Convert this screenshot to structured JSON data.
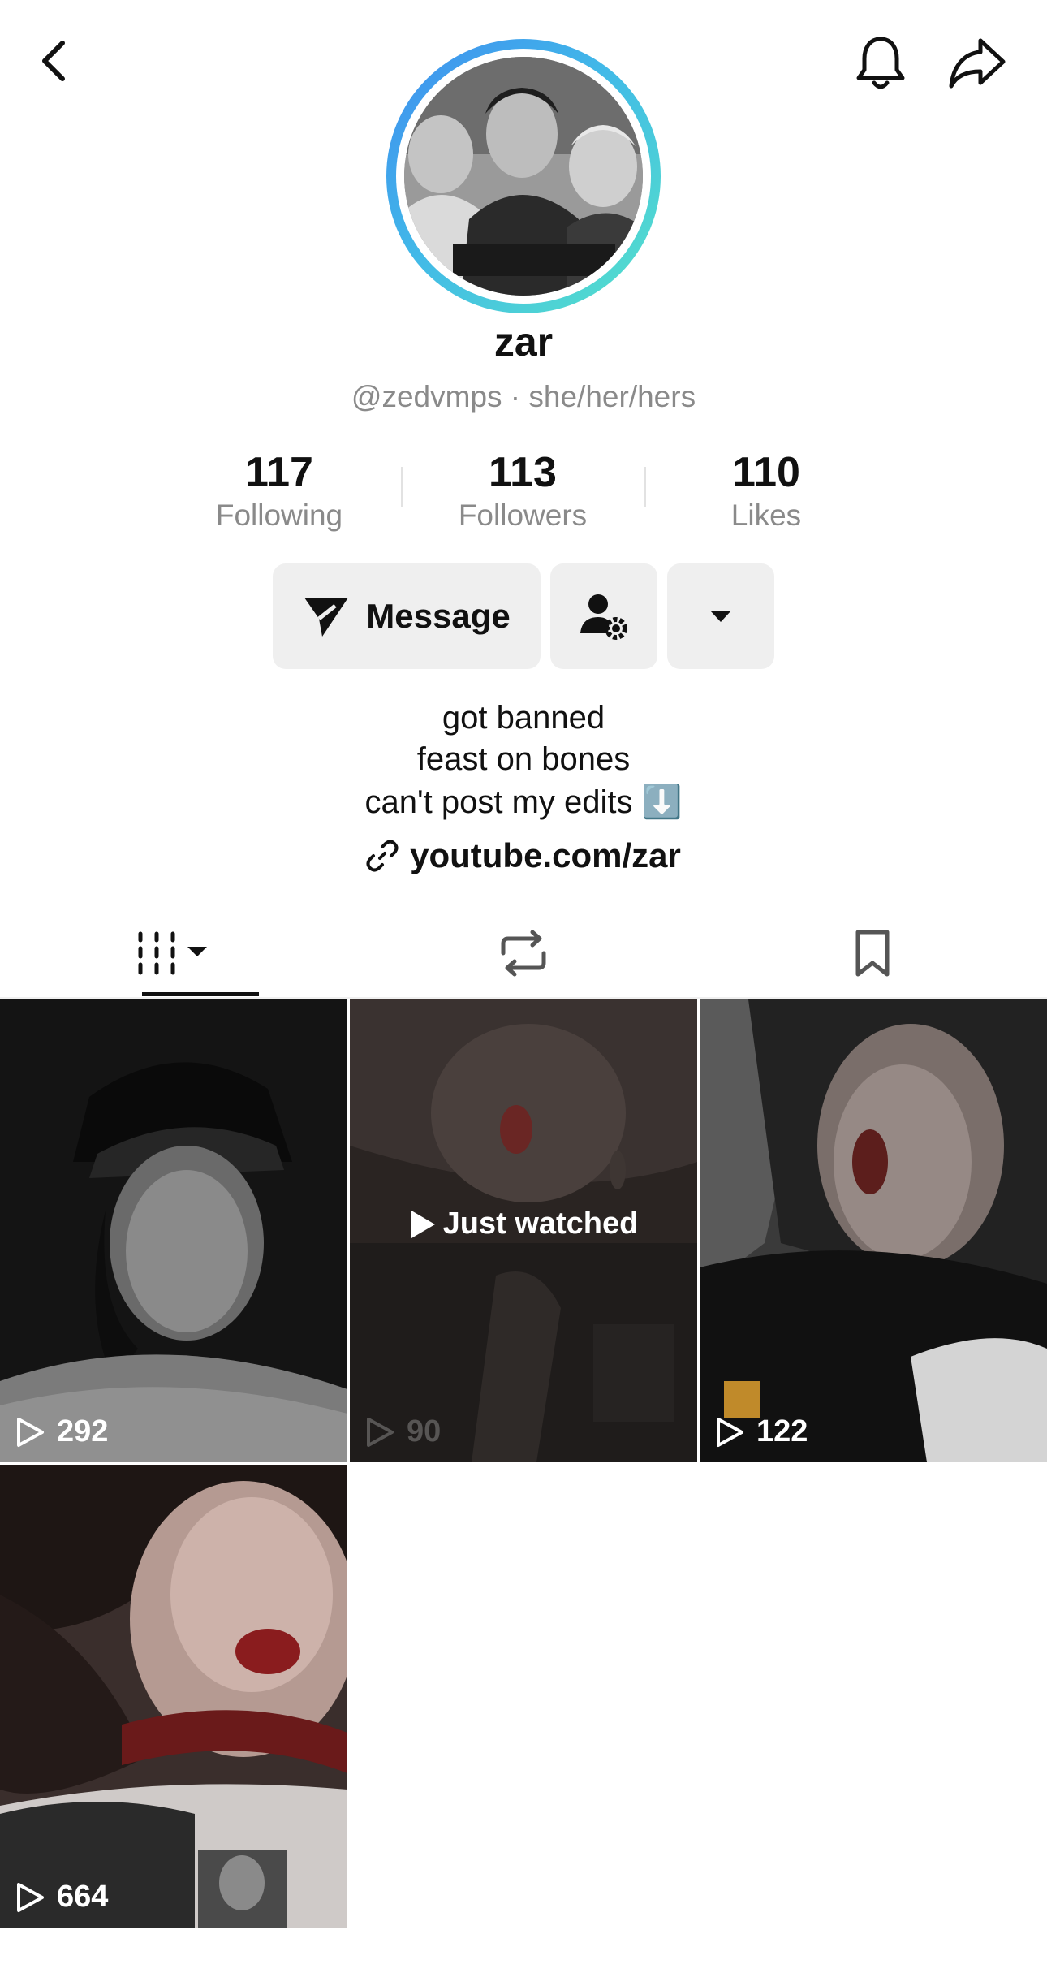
{
  "profile": {
    "name": "zar",
    "handle_line": "@zedvmps · she/her/hers"
  },
  "stats": [
    {
      "value": "117",
      "label": "Following"
    },
    {
      "value": "113",
      "label": "Followers"
    },
    {
      "value": "110",
      "label": "Likes"
    }
  ],
  "actions": {
    "message_label": "Message"
  },
  "bio": {
    "line1": "got banned",
    "line2": "feast on bones",
    "line3": "can't post my edits ⬇️",
    "link": "youtube.com/zar"
  },
  "tabs": [
    "videos-grid-icon",
    "repost-icon",
    "bookmark-icon"
  ],
  "videos": [
    {
      "views": "292"
    },
    {
      "views": "90",
      "overlay": "Just watched"
    },
    {
      "views": "122"
    },
    {
      "views": "664"
    }
  ],
  "colors": {
    "ring_start": "#3f8cf0",
    "ring_end": "#56e3c8",
    "button_bg": "#efefef",
    "secondary_text": "#8a8a8a"
  }
}
